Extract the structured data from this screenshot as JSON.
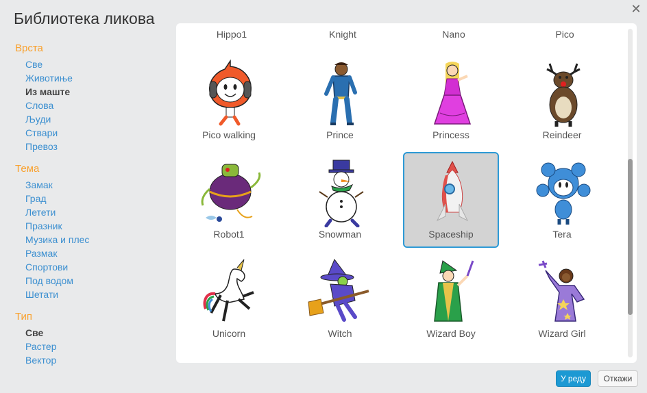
{
  "dialog": {
    "title": "Библиотека ликова",
    "close_icon": "close-icon"
  },
  "sidebar": {
    "groups": [
      {
        "heading": "Врста",
        "items": [
          {
            "label": "Све",
            "selected": false
          },
          {
            "label": "Животиње",
            "selected": false
          },
          {
            "label": "Из маште",
            "selected": true
          },
          {
            "label": "Слова",
            "selected": false
          },
          {
            "label": "Људи",
            "selected": false
          },
          {
            "label": "Ствари",
            "selected": false
          },
          {
            "label": "Превоз",
            "selected": false
          }
        ]
      },
      {
        "heading": "Тема",
        "items": [
          {
            "label": "Замак",
            "selected": false
          },
          {
            "label": "Град",
            "selected": false
          },
          {
            "label": "Летети",
            "selected": false
          },
          {
            "label": "Празник",
            "selected": false
          },
          {
            "label": "Музика и плес",
            "selected": false
          },
          {
            "label": "Размак",
            "selected": false
          },
          {
            "label": "Спортови",
            "selected": false
          },
          {
            "label": "Под водом",
            "selected": false
          },
          {
            "label": "Шетати",
            "selected": false
          }
        ]
      },
      {
        "heading": "Тип",
        "items": [
          {
            "label": "Све",
            "selected": true
          },
          {
            "label": "Растер",
            "selected": false
          },
          {
            "label": "Вектор",
            "selected": false
          }
        ]
      }
    ]
  },
  "library": {
    "top_names": [
      "Hippo1",
      "Knight",
      "Nano",
      "Pico"
    ],
    "sprites": [
      {
        "name": "Pico walking",
        "icon": "pico-walking-icon",
        "selected": false
      },
      {
        "name": "Prince",
        "icon": "prince-icon",
        "selected": false
      },
      {
        "name": "Princess",
        "icon": "princess-icon",
        "selected": false
      },
      {
        "name": "Reindeer",
        "icon": "reindeer-icon",
        "selected": false
      },
      {
        "name": "Robot1",
        "icon": "robot-icon",
        "selected": false
      },
      {
        "name": "Snowman",
        "icon": "snowman-icon",
        "selected": false
      },
      {
        "name": "Spaceship",
        "icon": "spaceship-icon",
        "selected": true
      },
      {
        "name": "Tera",
        "icon": "tera-icon",
        "selected": false
      },
      {
        "name": "Unicorn",
        "icon": "unicorn-icon",
        "selected": false
      },
      {
        "name": "Witch",
        "icon": "witch-icon",
        "selected": false
      },
      {
        "name": "Wizard Boy",
        "icon": "wizard-boy-icon",
        "selected": false
      },
      {
        "name": "Wizard Girl",
        "icon": "wizard-girl-icon",
        "selected": false
      }
    ]
  },
  "footer": {
    "ok_label": "У реду",
    "cancel_label": "Откажи"
  },
  "colors": {
    "accent": "#1c99d3",
    "heading": "#f9a12e",
    "link": "#3b8fd0",
    "selection": "#2d9ad6"
  }
}
